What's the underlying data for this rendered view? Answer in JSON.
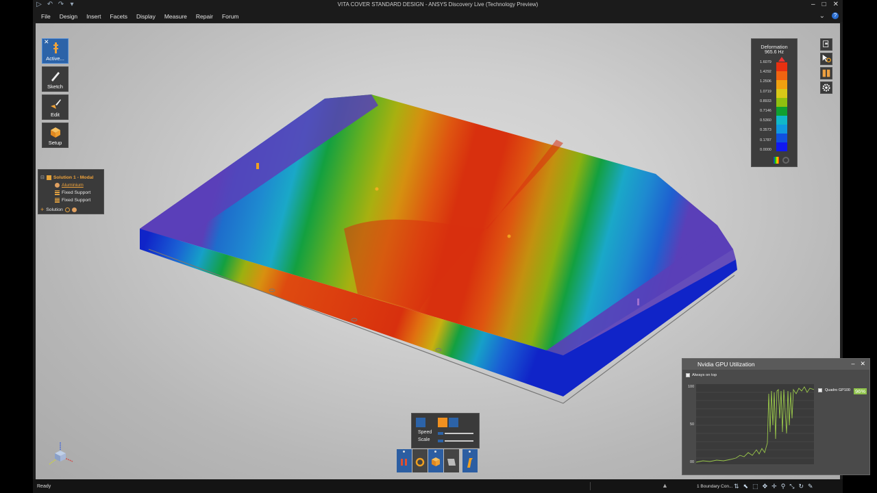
{
  "window": {
    "title": "VITA COVER STANDARD DESIGN - ANSYS Discovery Live (Technology Preview)"
  },
  "menu": [
    "File",
    "Design",
    "Insert",
    "Facets",
    "Display",
    "Measure",
    "Repair",
    "Forum"
  ],
  "toolbar": [
    {
      "label": "Active...",
      "icon": "simulation-icon",
      "active": true
    },
    {
      "label": "Sketch",
      "icon": "pencil-icon",
      "active": false
    },
    {
      "label": "Edit",
      "icon": "brush-icon",
      "active": false
    },
    {
      "label": "Setup",
      "icon": "cube-icon",
      "active": false
    }
  ],
  "tree": {
    "root": "Solution 1 - Modal",
    "material": "Aluminium",
    "supports": [
      "Fixed Support",
      "Fixed Support"
    ],
    "add_solution": "Solution"
  },
  "legend": {
    "title": "Deformation",
    "frequency": "965.6 Hz",
    "values": [
      "1.6079",
      "1.4292",
      "1.2506",
      "1.0719",
      "0.8933",
      "0.7146",
      "0.5360",
      "0.3573",
      "0.1787",
      "0.0000"
    ],
    "colors": [
      "#e83010",
      "#f06410",
      "#f0a010",
      "#d8c818",
      "#90c010",
      "#10a030",
      "#10b8c8",
      "#1098e0",
      "#1050e0",
      "#1018f0"
    ]
  },
  "playback": {
    "speed_label": "Speed",
    "scale_label": "Scale"
  },
  "gpu": {
    "title": "Nvidia GPU Utilization",
    "always_on_top": "Always on top",
    "device": "Quadro GP100",
    "percent": "96%",
    "y_labels": [
      "100",
      "50",
      "00"
    ]
  },
  "status": {
    "ready": "Ready",
    "boundary": "1 Boundary Con..."
  }
}
